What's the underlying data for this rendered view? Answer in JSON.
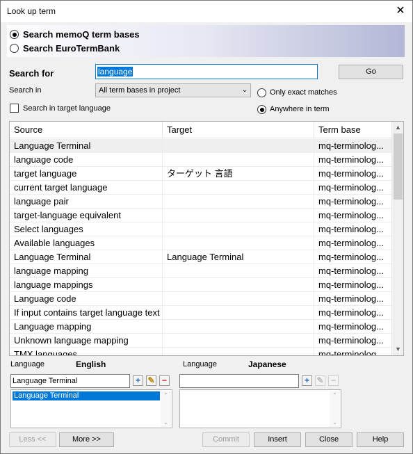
{
  "window": {
    "title": "Look up term",
    "close_glyph": "✕"
  },
  "search_source": {
    "options": [
      {
        "label": "Search memoQ term bases",
        "selected": true
      },
      {
        "label": "Search EuroTermBank",
        "selected": false
      }
    ]
  },
  "search": {
    "label": "Search for",
    "value": "language",
    "go_label": "Go",
    "search_in_label": "Search in",
    "search_in_value": "All term bases in project",
    "target_lang_label": "Search in target language",
    "target_lang_checked": false,
    "match_options": [
      {
        "label": "Only exact matches",
        "selected": false
      },
      {
        "label": "Anywhere in term",
        "selected": true
      }
    ]
  },
  "results": {
    "columns": [
      "Source",
      "Target",
      "Term base"
    ],
    "rows": [
      {
        "source": "Language Terminal",
        "target": "",
        "termbase": "mq-terminolog..."
      },
      {
        "source": "language code",
        "target": "",
        "termbase": "mq-terminolog..."
      },
      {
        "source": "target language",
        "target": "ターゲット 言語",
        "termbase": "mq-terminolog..."
      },
      {
        "source": "current target language",
        "target": "",
        "termbase": "mq-terminolog..."
      },
      {
        "source": "language pair",
        "target": "",
        "termbase": "mq-terminolog..."
      },
      {
        "source": "target-language equivalent",
        "target": "",
        "termbase": "mq-terminolog..."
      },
      {
        "source": "Select languages",
        "target": "",
        "termbase": "mq-terminolog..."
      },
      {
        "source": "Available languages",
        "target": "",
        "termbase": "mq-terminolog..."
      },
      {
        "source": "Language Terminal",
        "target": "Language Terminal",
        "termbase": "mq-terminolog..."
      },
      {
        "source": "language mapping",
        "target": "",
        "termbase": "mq-terminolog..."
      },
      {
        "source": "language mappings",
        "target": "",
        "termbase": "mq-terminolog..."
      },
      {
        "source": "Language code",
        "target": "",
        "termbase": "mq-terminolog..."
      },
      {
        "source": "If input contains target language text",
        "target": "",
        "termbase": "mq-terminolog..."
      },
      {
        "source": "Language mapping",
        "target": "",
        "termbase": "mq-terminolog..."
      },
      {
        "source": "Unknown language mapping",
        "target": "",
        "termbase": "mq-terminolog..."
      },
      {
        "source": "TMX languages",
        "target": "",
        "termbase": "mq-terminolog..."
      }
    ]
  },
  "source_panel": {
    "lang_label": "Language",
    "lang_value": "English",
    "term_value": "Language Terminal",
    "list_items": [
      "Language Terminal"
    ]
  },
  "target_panel": {
    "lang_label": "Language",
    "lang_value": "Japanese",
    "term_value": "",
    "list_items": []
  },
  "buttons": {
    "less": "Less <<",
    "more": "More >>",
    "commit": "Commit",
    "insert": "Insert",
    "close": "Close",
    "help": "Help"
  },
  "icons": {
    "add": "add-term-icon",
    "edit": "edit-term-icon",
    "delete": "delete-term-icon"
  }
}
